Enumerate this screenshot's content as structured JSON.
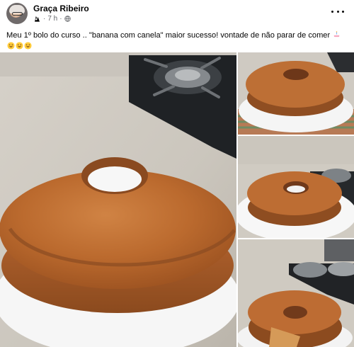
{
  "post": {
    "author": "Graça Ribeiro",
    "time": "7 h",
    "separator": "·",
    "text": "Meu 1º bolo do curso .. \"banana com canela\" maior sucesso!  vontade de não parar de comer",
    "trailing_emojis": [
      "birthday-cake-emoji",
      "grinning-face-emoji",
      "grinning-face-emoji",
      "grinning-face-emoji"
    ]
  },
  "icons": {
    "group": "group-icon",
    "audience": "globe-icon",
    "more": "more-options-icon"
  },
  "colors": {
    "text": "#050505",
    "secondary_text": "#65676b",
    "background": "#ffffff",
    "cake": "#b9652b",
    "cake_top": "#c97b3d",
    "plate": "#f7f7f7",
    "stove": "#24272a"
  },
  "photos": [
    "photo-main",
    "photo-side-1",
    "photo-side-2",
    "photo-side-3"
  ]
}
